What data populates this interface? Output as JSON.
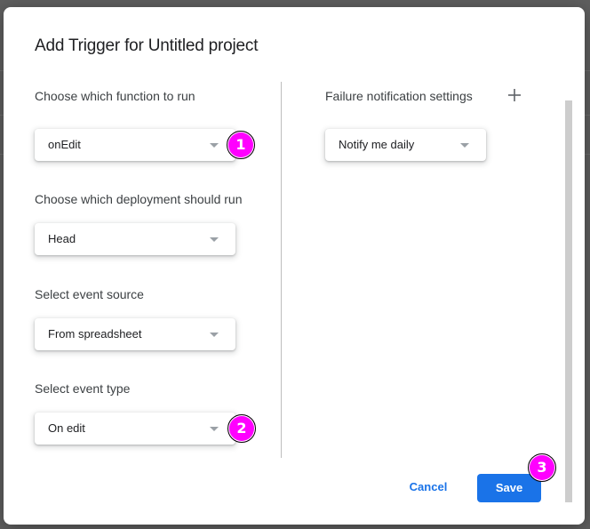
{
  "dialog": {
    "title": "Add Trigger for Untitled project"
  },
  "left_column": {
    "function": {
      "label": "Choose which function to run",
      "value": "onEdit"
    },
    "deployment": {
      "label": "Choose which deployment should run",
      "value": "Head"
    },
    "event_source": {
      "label": "Select event source",
      "value": "From spreadsheet"
    },
    "event_type": {
      "label": "Select event type",
      "value": "On edit"
    }
  },
  "right_column": {
    "failure_notification": {
      "label": "Failure notification settings",
      "value": "Notify me daily",
      "add_icon": "plus-icon"
    }
  },
  "footer": {
    "cancel_label": "Cancel",
    "save_label": "Save"
  },
  "annotations": {
    "badge_1": "1",
    "badge_2": "2",
    "badge_3": "3",
    "color": "#ff00ff"
  },
  "colors": {
    "accent": "#1a73e8",
    "overlay": "#5f5f5f",
    "scrollbar": "#cdcdcd"
  }
}
